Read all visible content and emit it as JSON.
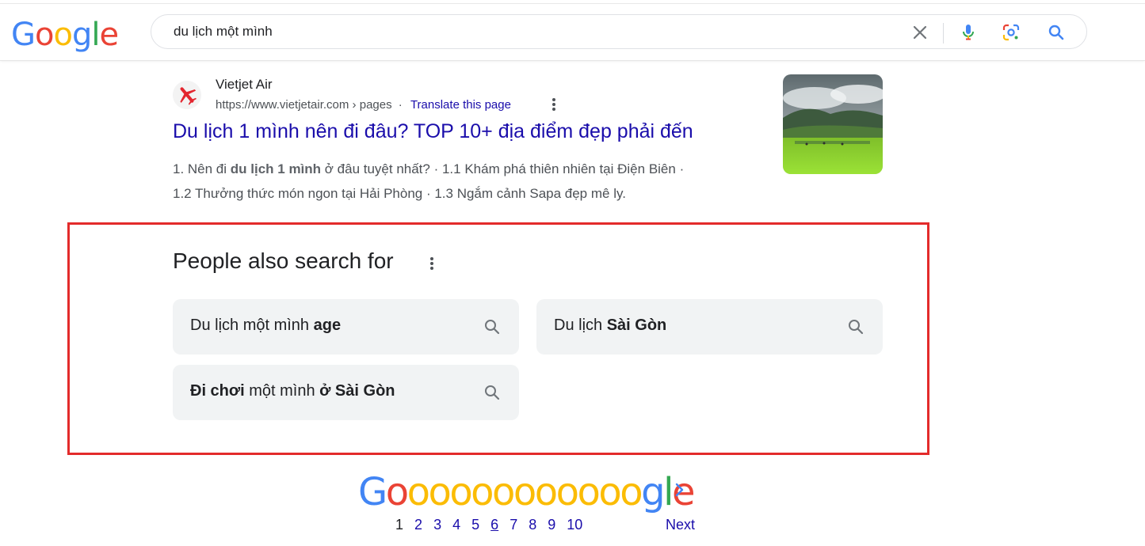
{
  "header": {
    "logo_letters": [
      "G",
      "o",
      "o",
      "g",
      "l",
      "e"
    ],
    "search_query": "du lịch một mình"
  },
  "result": {
    "site_name": "Vietjet Air",
    "site_url": "https://www.vietjetair.com › pages",
    "translate_label": "Translate this page",
    "title": "Du lịch 1 mình nên đi đâu? TOP 10+ địa điểm đẹp phải đến",
    "snippet_parts": {
      "p1": "1. Nên đi ",
      "bold": "du lịch 1 mình",
      "p2": " ở đâu tuyệt nhất? · 1.1 Khám phá thiên nhiên tại Điện Biên ·",
      "line2": "1.2 Thưởng thức món ngon tại Hải Phòng · 1.3 Ngắm cảnh Sapa đẹp mê ly."
    }
  },
  "people_also_search": {
    "heading": "People also search for",
    "items": [
      {
        "plain": "Du lịch một mình ",
        "bold": "age"
      },
      {
        "plain": "Du lịch ",
        "bold": "Sài Gòn"
      },
      {
        "bold1": "Đi chơi",
        "plain": " một mình ",
        "bold2": "ở Sài Gòn"
      }
    ]
  },
  "pagination": {
    "logo_text": {
      "g1": "G",
      "o_red": "o",
      "o_yellow": "ooooooooooo",
      "g2": "g",
      "l": "l",
      "e": "e"
    },
    "pages": [
      "1",
      "2",
      "3",
      "4",
      "5",
      "6",
      "7",
      "8",
      "9",
      "10"
    ],
    "current_page": "1",
    "next_label": "Next"
  },
  "colors": {
    "link": "#1a0dab",
    "highlight": "#e32b2b",
    "google_blue": "#4285f4",
    "google_red": "#ea4335",
    "google_yellow": "#fbbc05",
    "google_green": "#34a853"
  },
  "icons": {
    "clear": "close-icon",
    "voice": "microphone-icon",
    "lens": "camera-lens-icon",
    "search": "search-icon",
    "more": "more-vert-icon",
    "next": "chevron-right-icon"
  }
}
